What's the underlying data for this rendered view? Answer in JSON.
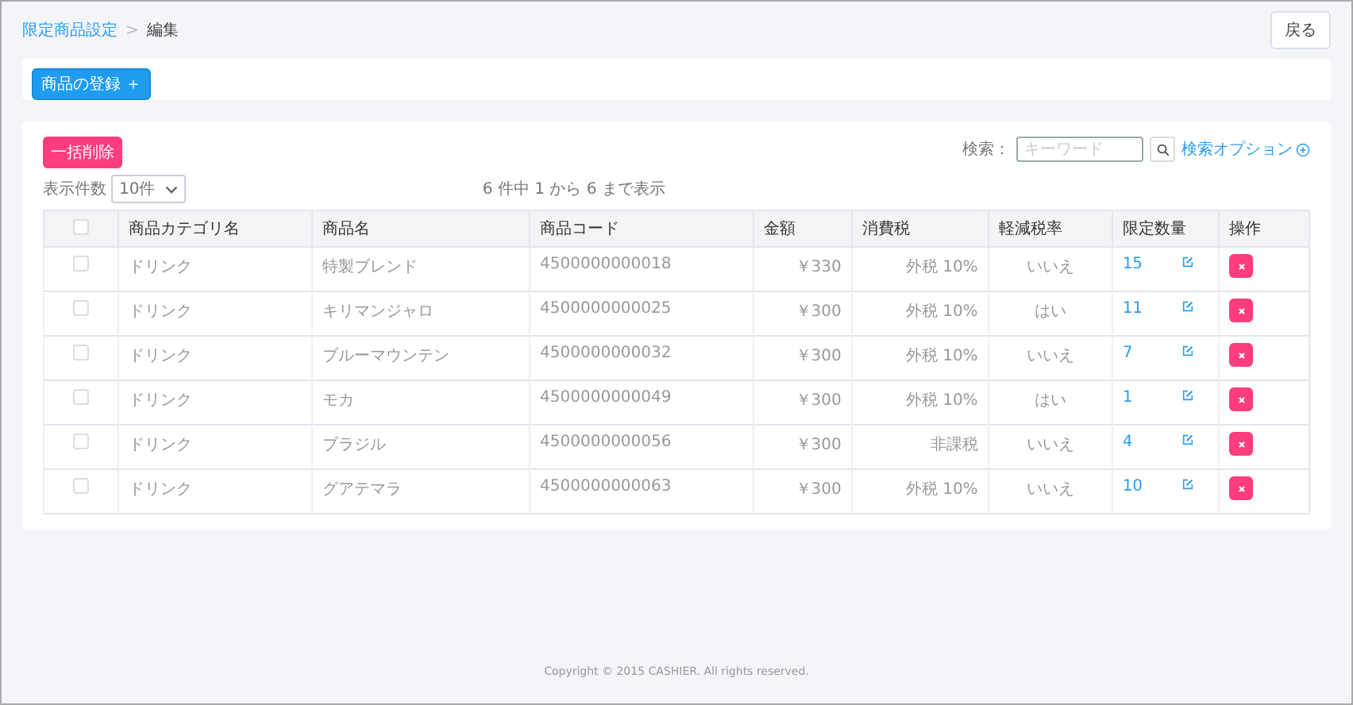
{
  "breadcrumb": {
    "parent": "限定商品設定",
    "separator": ">",
    "current": "編集"
  },
  "back_button": "戻る",
  "register_button": "商品の登録 ＋",
  "bulk_delete_button": "一括削除",
  "page_size": {
    "label": "表示件数",
    "value": "10件"
  },
  "summary": "6 件中 1 から 6 まで表示",
  "search": {
    "label": "検索：",
    "placeholder": "キーワード",
    "options_link": "検索オプション"
  },
  "table": {
    "select_all": {
      "checked": false
    },
    "columns": [
      "商品カテゴリ名",
      "商品名",
      "商品コード",
      "金額",
      "消費税",
      "軽減税率",
      "限定数量",
      "操作"
    ],
    "rows": [
      {
        "checked": false,
        "category": "ドリンク",
        "name": "特製ブレンド",
        "code": "4500000000018",
        "price": "￥330",
        "tax": "外税 10%",
        "reduced": "いいえ",
        "limit": "15"
      },
      {
        "checked": false,
        "category": "ドリンク",
        "name": "キリマンジャロ",
        "code": "4500000000025",
        "price": "￥300",
        "tax": "外税 10%",
        "reduced": "はい",
        "limit": "11"
      },
      {
        "checked": false,
        "category": "ドリンク",
        "name": "ブルーマウンテン",
        "code": "4500000000032",
        "price": "￥300",
        "tax": "外税 10%",
        "reduced": "いいえ",
        "limit": "7"
      },
      {
        "checked": false,
        "category": "ドリンク",
        "name": "モカ",
        "code": "4500000000049",
        "price": "￥300",
        "tax": "外税 10%",
        "reduced": "はい",
        "limit": "1"
      },
      {
        "checked": false,
        "category": "ドリンク",
        "name": "ブラジル",
        "code": "4500000000056",
        "price": "￥300",
        "tax": "非課税",
        "reduced": "いいえ",
        "limit": "4"
      },
      {
        "checked": false,
        "category": "ドリンク",
        "name": "グアテマラ",
        "code": "4500000000063",
        "price": "￥300",
        "tax": "外税 10%",
        "reduced": "いいえ",
        "limit": "10"
      }
    ]
  },
  "footer": "Copyright © 2015 CASHIER. All rights reserved."
}
